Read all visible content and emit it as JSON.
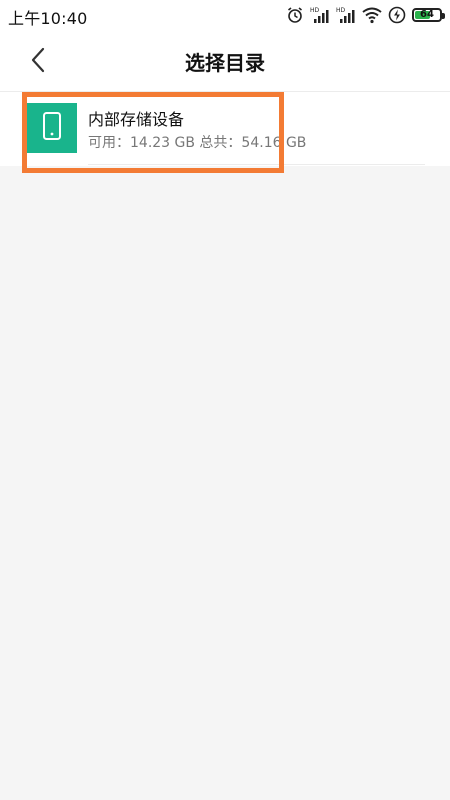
{
  "status_bar": {
    "time": "上午10:40",
    "battery_level": "64",
    "battery_fraction": 0.64,
    "icons": [
      "alarm-icon",
      "signal-hd-icon",
      "signal-hd-icon",
      "wifi-icon",
      "charging-icon",
      "battery-icon"
    ]
  },
  "header": {
    "title": "选择目录",
    "back_icon": "chevron-left-icon"
  },
  "storage": {
    "name": "内部存储设备",
    "info": "可用：14.23 GB 总共：54.16 GB",
    "icon": "phone-icon",
    "icon_color": "#19b48c"
  },
  "colors": {
    "highlight": "#f37b34",
    "background": "#f5f5f5",
    "battery_green": "#2bb24c"
  }
}
